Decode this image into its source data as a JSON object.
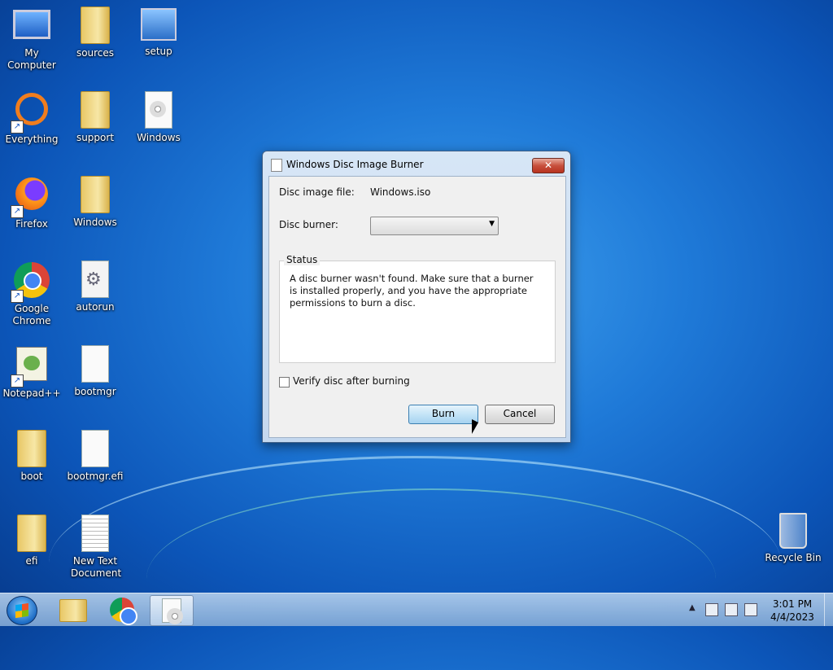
{
  "desktop": {
    "icons": [
      {
        "label": "My Computer"
      },
      {
        "label": "sources"
      },
      {
        "label": "setup"
      },
      {
        "label": "Everything"
      },
      {
        "label": "support"
      },
      {
        "label": "Windows"
      },
      {
        "label": "Firefox"
      },
      {
        "label": "Windows"
      },
      {
        "label": "Google Chrome"
      },
      {
        "label": "autorun"
      },
      {
        "label": "Notepad++"
      },
      {
        "label": "bootmgr"
      },
      {
        "label": "boot"
      },
      {
        "label": "bootmgr.efi"
      },
      {
        "label": "efi"
      },
      {
        "label": "New Text Document"
      },
      {
        "label": "Recycle Bin"
      }
    ]
  },
  "dialog": {
    "title": "Windows Disc Image Burner",
    "close_label": "✕",
    "disc_image_label": "Disc image file:",
    "disc_image_value": "Windows.iso",
    "disc_burner_label": "Disc burner:",
    "disc_burner_value": "",
    "status_legend": "Status",
    "status_text": "A disc burner wasn't found. Make sure that a burner is installed properly, and you have the appropriate permissions to burn a disc.",
    "verify_label": "Verify disc after burning",
    "verify_checked": false,
    "burn_label": "Burn",
    "cancel_label": "Cancel"
  },
  "taskbar": {
    "time": "3:01 PM",
    "date": "4/4/2023",
    "tray_up_arrow": "▲"
  }
}
